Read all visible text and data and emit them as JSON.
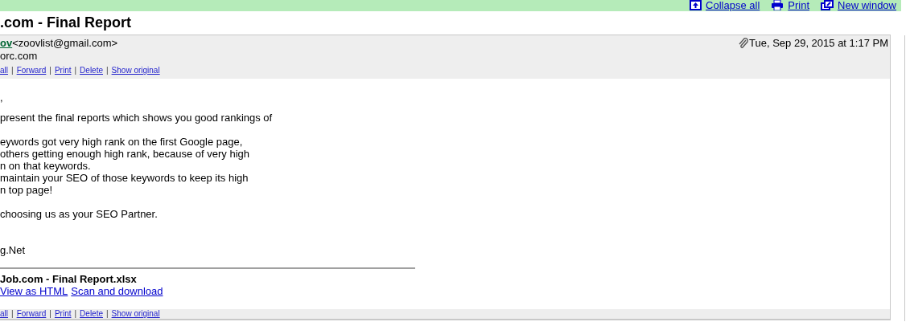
{
  "toolbar": {
    "links": [
      {
        "kind": "collapse",
        "label": "Collapse all"
      },
      {
        "kind": "print",
        "label": "Print"
      },
      {
        "kind": "newwindow",
        "label": "New window"
      }
    ]
  },
  "subject": ".com - Final Report",
  "message": {
    "sender_name": "ov",
    "sender_email": "<zoovlist@gmail.com>",
    "recipient": "orc.com",
    "date": "Tue, Sep 29, 2015 at 1:17 PM",
    "has_attachment": true,
    "action_separator": "|",
    "actions_top": [
      "all",
      "Forward",
      "Print",
      "Delete",
      "Show original"
    ],
    "body": [
      [
        ","
      ],
      [
        "present the final reports which shows you good rankings of"
      ],
      [
        "eywords got very high rank on the first Google page,",
        "others getting enough high rank, because of very high",
        "n on that keywords.",
        "maintain your SEO of those keywords to keep its high",
        "n top page!"
      ],
      [
        "choosing us as your SEO Partner."
      ],
      [
        "g.Net"
      ]
    ],
    "attachment": {
      "name": "Job.com - Final Report.xlsx",
      "links": [
        "View as HTML",
        "Scan and download"
      ]
    },
    "actions_bottom": [
      "all",
      "Forward",
      "Print",
      "Delete",
      "Show original"
    ]
  }
}
